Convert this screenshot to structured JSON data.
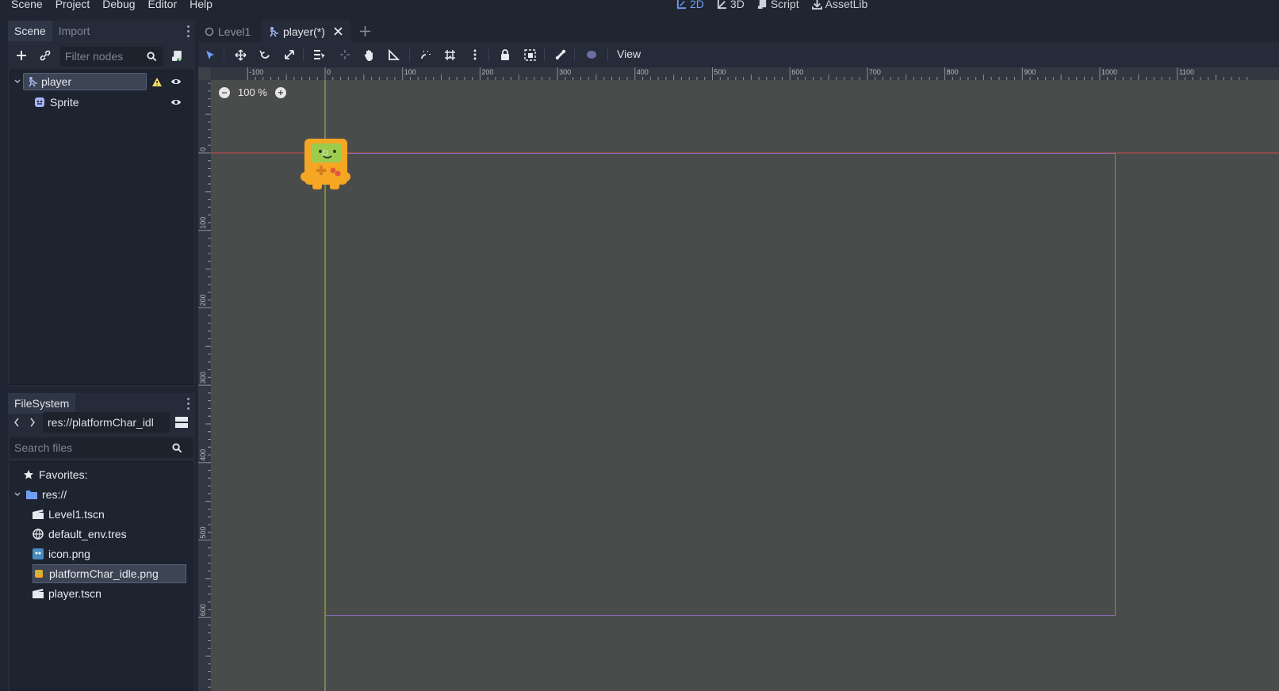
{
  "menu": [
    "Scene",
    "Project",
    "Debug",
    "Editor",
    "Help"
  ],
  "main_screens": [
    {
      "label": "2D",
      "active": true
    },
    {
      "label": "3D",
      "active": false
    },
    {
      "label": "Script",
      "active": false
    },
    {
      "label": "AssetLib",
      "active": false
    }
  ],
  "scene_dock": {
    "tabs": [
      "Scene",
      "Import"
    ],
    "filter_placeholder": "Filter nodes",
    "nodes": [
      {
        "label": "player",
        "icon": "kinematic-body-icon",
        "selected": true,
        "warning": true
      },
      {
        "label": "Sprite",
        "icon": "sprite-icon",
        "selected": false,
        "warning": false
      }
    ]
  },
  "filesystem_dock": {
    "tab": "FileSystem",
    "path": "res://platformChar_idl",
    "search_placeholder": "Search files",
    "favorites_label": "Favorites:",
    "root_label": "res://",
    "files": [
      {
        "name": "Level1.tscn",
        "icon": "scene-file-icon"
      },
      {
        "name": "default_env.tres",
        "icon": "environment-icon"
      },
      {
        "name": "icon.png",
        "icon": "image-icon"
      },
      {
        "name": "platformChar_idle.png",
        "icon": "image-icon",
        "selected": true
      },
      {
        "name": "player.tscn",
        "icon": "scene-file-icon"
      }
    ]
  },
  "editor_tabs": [
    {
      "label": "Level1",
      "active": false
    },
    {
      "label": "player(*)",
      "active": true
    }
  ],
  "toolbar": {
    "view_label": "View"
  },
  "viewport": {
    "zoom_label": "100 %",
    "ruler_x_labels": [
      "-100",
      "0",
      "100",
      "200",
      "300",
      "400",
      "500",
      "600",
      "700",
      "800",
      "900",
      "1000",
      "1100"
    ],
    "ruler_y_labels": [
      "0",
      "100",
      "200",
      "300",
      "400",
      "500",
      "600"
    ]
  },
  "colors": {
    "accent": "#6f9df0",
    "warning": "#ffdd65",
    "axis_x": "#c84a4a",
    "axis_y": "#a7c04a",
    "viewport_rect": "#8a6fb8"
  }
}
